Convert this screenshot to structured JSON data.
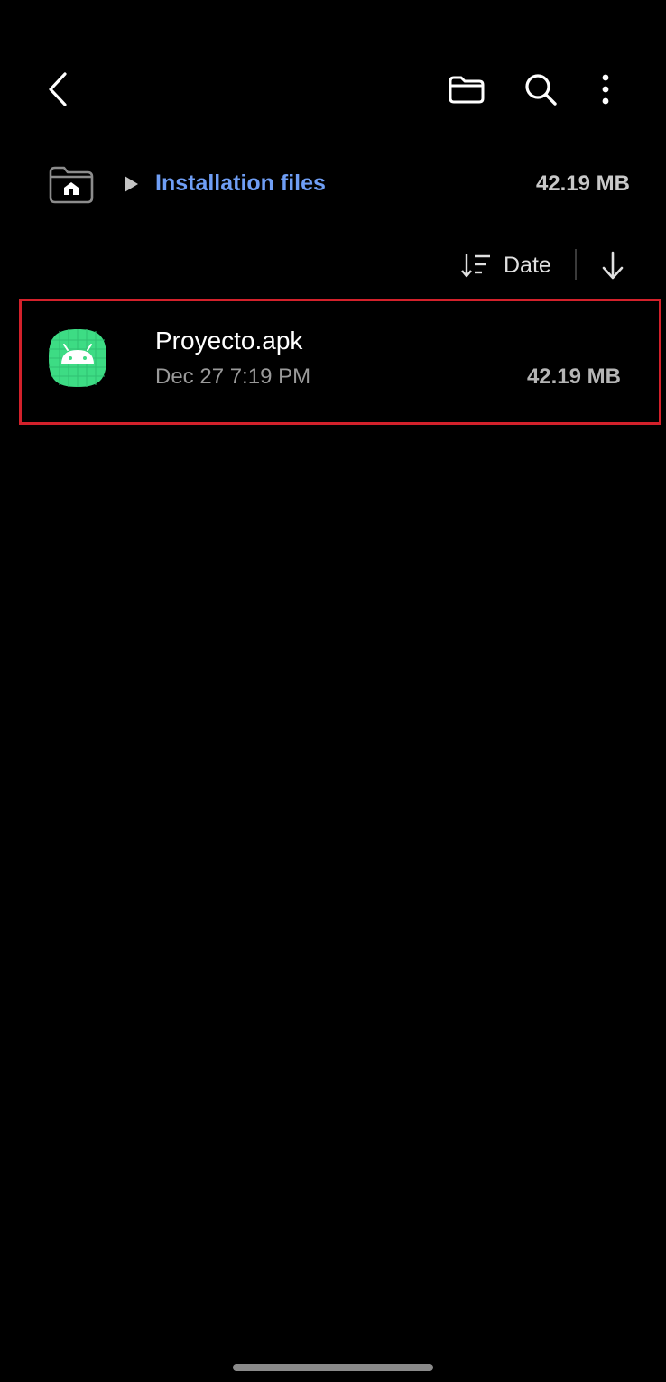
{
  "toolbar": {
    "back_icon": "back-chevron-icon",
    "folder_icon": "folder-icon",
    "search_icon": "search-icon",
    "more_icon": "more-vertical-icon"
  },
  "breadcrumb": {
    "home_icon": "home-folder-icon",
    "separator_icon": "play-triangle-icon",
    "current_folder": "Installation files",
    "storage_size": "42.19 MB",
    "accent_color": "#6f9ef5"
  },
  "sort": {
    "sort_icon": "sort-list-icon",
    "label": "Date",
    "direction_icon": "arrow-down-icon"
  },
  "files": [
    {
      "icon": "android-apk-icon",
      "name": "Proyecto.apk",
      "date": "Dec 27 7:19 PM",
      "size": "42.19 MB",
      "highlight_color": "#d3212b"
    }
  ]
}
